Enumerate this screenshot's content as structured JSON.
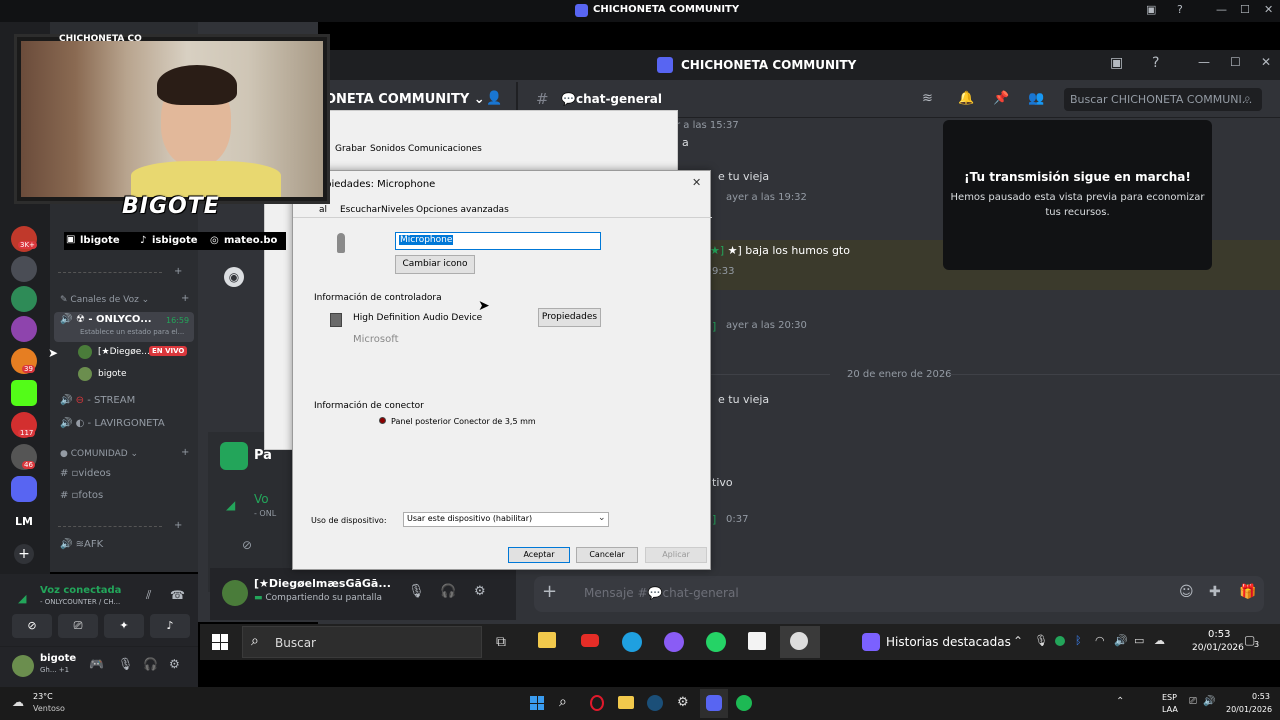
{
  "outer_window": {
    "title": "CHICHONETA COMMUNITY",
    "server_badges": [
      "3K+",
      "39",
      "117",
      "46"
    ],
    "server_label_lm": "LM"
  },
  "webcam": {
    "partial_title": "CHICHONETA CO",
    "brand": "BIGOTE",
    "socials": [
      "lbigote",
      "isbigote",
      "mateo.bo"
    ]
  },
  "outer_channels": {
    "voice_category": "Canales de Voz",
    "voice_channel_1": "- ONLYCO...",
    "voice_channel_1_time": "16:59",
    "voice_channel_1_status": "Establece un estado para el...",
    "member_1": "[★Diegøe...",
    "member_1_badge": "EN VIVO",
    "member_2": "bigote",
    "voice_channel_2": "- STREAM",
    "voice_channel_3": "- LAVIRGONETA",
    "community_category": "COMUNIDAD",
    "text_channel_1": "videos",
    "text_channel_2": "fotos",
    "afk_channel": "AFK"
  },
  "voice_panel": {
    "status": "Voz conectada",
    "channel": "- ONLYCOUNTER / CH...",
    "user_name": "bigote",
    "user_sub": "Gh... +1"
  },
  "outer_taskbar": {
    "weather_temp": "23°C",
    "weather_desc": "Ventoso",
    "lang_1": "ESP",
    "lang_2": "LAA",
    "time": "0:53",
    "date": "20/01/2026"
  },
  "nested_discord": {
    "window_title": "CHICHONETA COMMUNITY",
    "server_name": "ONETA COMMUNITY",
    "channel_name": "chat-general",
    "search_placeholder": "Buscar CHICHONETA COMMUNI...",
    "messages": [
      {
        "ts": "r a las 15:37",
        "text": "a"
      },
      {
        "ts": "ayer a las 19:32",
        "text": "e tu vieja"
      },
      {
        "ts": "9:33",
        "text": "★] baja los humos gto"
      },
      {
        "ts": "ayer a las 20:30",
        "text": "]"
      },
      {
        "ts": "",
        "text": "e tu vieja"
      },
      {
        "ts": "",
        "text": "tivo"
      },
      {
        "ts": "0:37",
        "text": "]"
      }
    ],
    "date_divider": "20 de enero de 2026",
    "stream_card": {
      "title": "¡Tu transmisión sigue en marcha!",
      "body": "Hemos pausado esta vista previa para economizar tus recursos."
    },
    "user_panel_name": "[★DiegøelmæsGāGā...",
    "user_panel_sub": "Compartiendo su pantalla",
    "partial_channel": "Pa",
    "partial_voice": "Vo",
    "partial_only": "- ONL",
    "message_placeholder": "Mensaje #💬chat-general"
  },
  "nested_taskbar": {
    "search": "Buscar",
    "highlights": "Historias destacadas",
    "time": "0:53",
    "date": "20/01/2026",
    "notif_count": "3"
  },
  "dialog_back": {
    "tabs": [
      "Grabar",
      "Sonidos",
      "Comunicaciones"
    ]
  },
  "dialog": {
    "title": "opiedades: Microphone",
    "tabs": [
      "al",
      "Escuchar",
      "Niveles",
      "Opciones avanzadas"
    ],
    "device_name": "Microphone",
    "change_icon": "Cambiar icono",
    "controller_heading": "Información de controladora",
    "controller_name": "High Definition Audio Device",
    "controller_vendor": "Microsoft",
    "properties_button": "Propiedades",
    "connector_heading": "Información de conector",
    "connector_name": "Panel posterior Conector de 3,5 mm",
    "usage_label": "Uso de dispositivo:",
    "usage_value": "Usar este dispositivo (habilitar)",
    "ok": "Aceptar",
    "cancel": "Cancelar",
    "apply": "Aplicar"
  },
  "colors": {
    "accent": "#5865f2",
    "live_red": "#da373c",
    "online_green": "#23a55a",
    "highlight_row": "#3b3a2c"
  }
}
